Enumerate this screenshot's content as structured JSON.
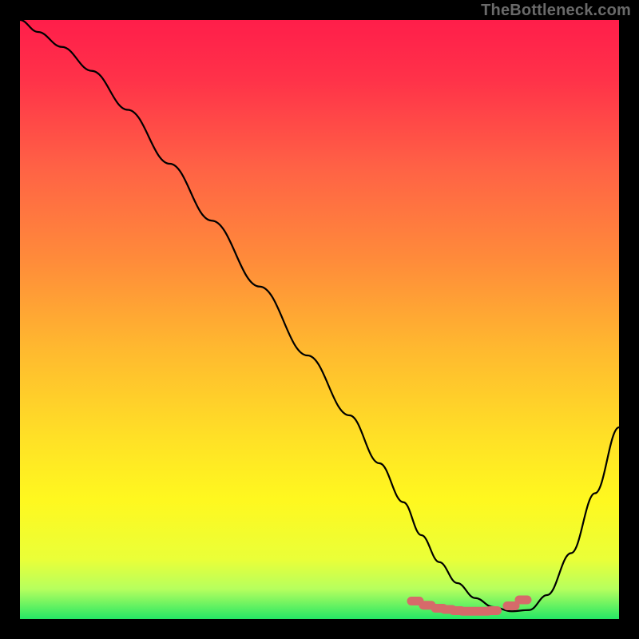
{
  "watermark": "TheBottleneck.com",
  "gradient": {
    "stops": [
      {
        "offset": 0.0,
        "color": "#ff1e4a"
      },
      {
        "offset": 0.1,
        "color": "#ff3249"
      },
      {
        "offset": 0.25,
        "color": "#ff6345"
      },
      {
        "offset": 0.4,
        "color": "#ff8b3a"
      },
      {
        "offset": 0.55,
        "color": "#ffb92f"
      },
      {
        "offset": 0.7,
        "color": "#ffe126"
      },
      {
        "offset": 0.8,
        "color": "#fff81f"
      },
      {
        "offset": 0.9,
        "color": "#eaff38"
      },
      {
        "offset": 0.95,
        "color": "#b6ff5e"
      },
      {
        "offset": 1.0,
        "color": "#24e765"
      }
    ]
  },
  "curve": {
    "stroke": "#000000",
    "stroke_width": 2.2
  },
  "marker": {
    "color": "#d66a6a",
    "stroke_width": 11
  },
  "chart_data": {
    "type": "line",
    "title": "",
    "xlabel": "",
    "ylabel": "",
    "xlim": [
      0,
      100
    ],
    "ylim": [
      0,
      100
    ],
    "series": [
      {
        "name": "bottleneck-curve",
        "x": [
          0,
          3,
          7,
          12,
          18,
          25,
          32,
          40,
          48,
          55,
          60,
          64,
          67,
          70,
          73,
          76,
          79,
          82,
          85,
          88,
          92,
          96,
          100
        ],
        "y": [
          100,
          98,
          95.5,
          91.5,
          85,
          76,
          66.5,
          55.5,
          44,
          34,
          26,
          19.5,
          14,
          9.5,
          6,
          3.5,
          2,
          1.3,
          1.5,
          4,
          11,
          21,
          32
        ]
      },
      {
        "name": "optimal-zone-markers",
        "x": [
          66,
          68,
          70,
          71.5,
          73,
          74.5,
          76,
          77.5,
          79,
          82,
          84
        ],
        "y": [
          3.0,
          2.3,
          1.8,
          1.6,
          1.4,
          1.3,
          1.3,
          1.3,
          1.4,
          2.2,
          3.2
        ]
      }
    ],
    "annotations": []
  }
}
